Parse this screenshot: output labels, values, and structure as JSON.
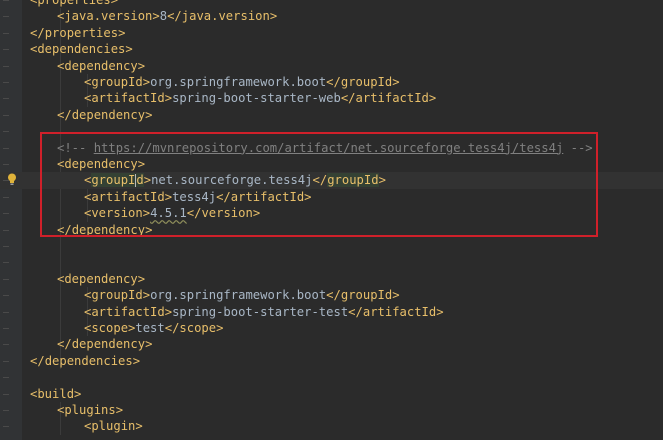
{
  "editor": {
    "lines": [
      {
        "indent": 0,
        "parts": [
          [
            "bracket",
            "<"
          ],
          [
            "tag",
            "properties"
          ],
          [
            "bracket",
            ">"
          ]
        ]
      },
      {
        "indent": 1,
        "parts": [
          [
            "bracket",
            "<"
          ],
          [
            "tag",
            "java.version"
          ],
          [
            "bracket",
            ">"
          ],
          [
            "txt",
            "8"
          ],
          [
            "bracket",
            "</"
          ],
          [
            "tag",
            "java.version"
          ],
          [
            "bracket",
            ">"
          ]
        ]
      },
      {
        "indent": 0,
        "parts": [
          [
            "bracket",
            "</"
          ],
          [
            "tag",
            "properties"
          ],
          [
            "bracket",
            ">"
          ]
        ]
      },
      {
        "indent": 0,
        "parts": [
          [
            "bracket",
            "<"
          ],
          [
            "tag",
            "dependencies"
          ],
          [
            "bracket",
            ">"
          ]
        ]
      },
      {
        "indent": 1,
        "parts": [
          [
            "bracket",
            "<"
          ],
          [
            "tag",
            "dependency"
          ],
          [
            "bracket",
            ">"
          ]
        ]
      },
      {
        "indent": 2,
        "parts": [
          [
            "bracket",
            "<"
          ],
          [
            "tag",
            "groupId"
          ],
          [
            "bracket",
            ">"
          ],
          [
            "txt",
            "org.springframework.boot"
          ],
          [
            "bracket",
            "</"
          ],
          [
            "tag",
            "groupId"
          ],
          [
            "bracket",
            ">"
          ]
        ]
      },
      {
        "indent": 2,
        "parts": [
          [
            "bracket",
            "<"
          ],
          [
            "tag",
            "artifactId"
          ],
          [
            "bracket",
            ">"
          ],
          [
            "txt",
            "spring-boot-starter-web"
          ],
          [
            "bracket",
            "</"
          ],
          [
            "tag",
            "artifactId"
          ],
          [
            "bracket",
            ">"
          ]
        ]
      },
      {
        "indent": 1,
        "parts": [
          [
            "bracket",
            "</"
          ],
          [
            "tag",
            "dependency"
          ],
          [
            "bracket",
            ">"
          ]
        ]
      },
      {
        "indent": 0,
        "parts": []
      },
      {
        "indent": 1,
        "parts": [
          [
            "cmt",
            "<!-- "
          ],
          [
            "cmt-link",
            "https://mvnrepository.com/artifact/net.sourceforge.tess4j/tess4j"
          ],
          [
            "cmt",
            " -->"
          ]
        ]
      },
      {
        "indent": 1,
        "parts": [
          [
            "bracket",
            "<"
          ],
          [
            "tag",
            "dependency"
          ],
          [
            "bracket",
            ">"
          ]
        ]
      },
      {
        "indent": 2,
        "caret": true,
        "parts": [
          [
            "bracket",
            "<"
          ],
          [
            "tag-hl-a",
            "groupI"
          ],
          [
            "caret",
            ""
          ],
          [
            "tag-hl-b",
            "d"
          ],
          [
            "bracket",
            ">"
          ],
          [
            "txt",
            "net.sourceforge.tess4j"
          ],
          [
            "bracket",
            "</"
          ],
          [
            "tag-hl",
            "groupId"
          ],
          [
            "bracket",
            ">"
          ]
        ]
      },
      {
        "indent": 2,
        "parts": [
          [
            "bracket",
            "<"
          ],
          [
            "tag",
            "artifactId"
          ],
          [
            "bracket",
            ">"
          ],
          [
            "txt",
            "tess4j"
          ],
          [
            "bracket",
            "</"
          ],
          [
            "tag",
            "artifactId"
          ],
          [
            "bracket",
            ">"
          ]
        ]
      },
      {
        "indent": 2,
        "parts": [
          [
            "bracket",
            "<"
          ],
          [
            "tag",
            "version"
          ],
          [
            "bracket",
            ">"
          ],
          [
            "txt-warn",
            "4.5.1"
          ],
          [
            "bracket",
            "</"
          ],
          [
            "tag",
            "version"
          ],
          [
            "bracket",
            ">"
          ]
        ]
      },
      {
        "indent": 1,
        "parts": [
          [
            "bracket",
            "</"
          ],
          [
            "tag",
            "dependency"
          ],
          [
            "bracket",
            ">"
          ]
        ]
      },
      {
        "indent": 0,
        "parts": []
      },
      {
        "indent": 0,
        "parts": []
      },
      {
        "indent": 1,
        "parts": [
          [
            "bracket",
            "<"
          ],
          [
            "tag",
            "dependency"
          ],
          [
            "bracket",
            ">"
          ]
        ]
      },
      {
        "indent": 2,
        "parts": [
          [
            "bracket",
            "<"
          ],
          [
            "tag",
            "groupId"
          ],
          [
            "bracket",
            ">"
          ],
          [
            "txt",
            "org.springframework.boot"
          ],
          [
            "bracket",
            "</"
          ],
          [
            "tag",
            "groupId"
          ],
          [
            "bracket",
            ">"
          ]
        ]
      },
      {
        "indent": 2,
        "parts": [
          [
            "bracket",
            "<"
          ],
          [
            "tag",
            "artifactId"
          ],
          [
            "bracket",
            ">"
          ],
          [
            "txt",
            "spring-boot-starter-test"
          ],
          [
            "bracket",
            "</"
          ],
          [
            "tag",
            "artifactId"
          ],
          [
            "bracket",
            ">"
          ]
        ]
      },
      {
        "indent": 2,
        "parts": [
          [
            "bracket",
            "<"
          ],
          [
            "tag",
            "scope"
          ],
          [
            "bracket",
            ">"
          ],
          [
            "txt",
            "test"
          ],
          [
            "bracket",
            "</"
          ],
          [
            "tag",
            "scope"
          ],
          [
            "bracket",
            ">"
          ]
        ]
      },
      {
        "indent": 1,
        "parts": [
          [
            "bracket",
            "</"
          ],
          [
            "tag",
            "dependency"
          ],
          [
            "bracket",
            ">"
          ]
        ]
      },
      {
        "indent": 0,
        "parts": [
          [
            "bracket",
            "</"
          ],
          [
            "tag",
            "dependencies"
          ],
          [
            "bracket",
            ">"
          ]
        ]
      },
      {
        "indent": 0,
        "parts": []
      },
      {
        "indent": 0,
        "parts": [
          [
            "bracket",
            "<"
          ],
          [
            "tag",
            "build"
          ],
          [
            "bracket",
            ">"
          ]
        ]
      },
      {
        "indent": 1,
        "parts": [
          [
            "bracket",
            "<"
          ],
          [
            "tag",
            "plugins"
          ],
          [
            "bracket",
            ">"
          ]
        ]
      },
      {
        "indent": 2,
        "parts": [
          [
            "bracket",
            "<"
          ],
          [
            "tag",
            "plugin"
          ],
          [
            "bracket",
            ">"
          ]
        ]
      }
    ]
  },
  "annotation": {
    "color": "#d0202a"
  },
  "gutter_icons": {
    "intention": "lightbulb-icon"
  }
}
